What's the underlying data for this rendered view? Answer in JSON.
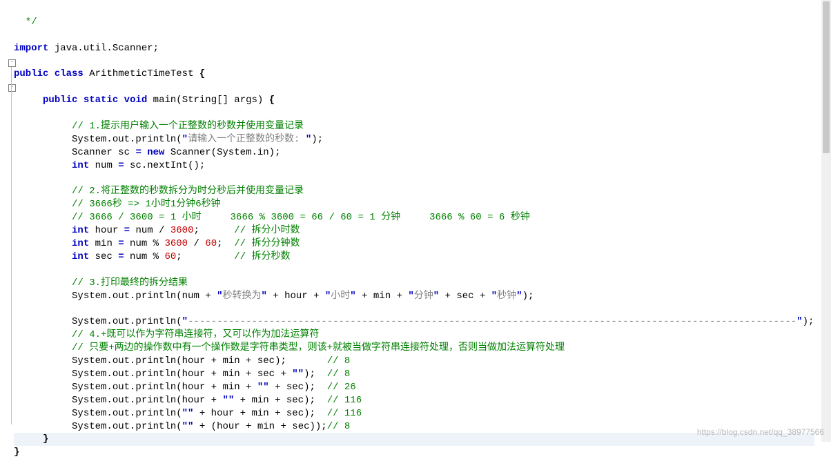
{
  "watermark": "https://blog.csdn.net/qq_38977566",
  "code": {
    "top_fragment": "  */",
    "import_kw": "import",
    "import_rest": " java.util.Scanner;",
    "class_kw1": "public",
    "class_kw2": "class",
    "class_name": " ArithmeticTimeTest ",
    "class_brace": "{",
    "main_kw1": "public",
    "main_kw2": "static",
    "main_kw3": "void",
    "main_sig": " main(String[] args) ",
    "main_brace": "{",
    "c1": "// 1.提示用户输入一个正整数的秒数并使用变量记录",
    "p1a": "System.out.println(",
    "p1q1": "\"",
    "p1s": "请输入一个正整数的秒数: ",
    "p1q2": "\"",
    "p1b": ");",
    "scan_a": "Scanner sc ",
    "scan_eq": "=",
    "scan_new": " new",
    "scan_b": " Scanner(System.in);",
    "int_kw": "int",
    "num_decl": " num ",
    "num_eq": "=",
    "num_rest": " sc.nextInt();",
    "c2a": "// 2.将正整数的秒数拆分为时分秒后并使用变量记录",
    "c2b": "// 3666秒 => 1小时1分钟6秒钟",
    "c2c": "// 3666 / 3600 = 1 小时     3666 % 3600 = 66 / 60 = 1 分钟     3666 % 60 = 6 秒钟",
    "hour_a": " hour ",
    "hour_eq": "=",
    "hour_b": " num / ",
    "hour_n": "3600",
    "hour_c": ";      ",
    "hour_cm": "// 拆分小时数",
    "min_a": " min ",
    "min_eq": "=",
    "min_b": " num % ",
    "min_n1": "3600",
    "min_c": " / ",
    "min_n2": "60",
    "min_d": ";  ",
    "min_cm": "// 拆分分钟数",
    "sec_a": " sec ",
    "sec_eq": "=",
    "sec_b": " num % ",
    "sec_n": "60",
    "sec_c": ";         ",
    "sec_cm": "// 拆分秒数",
    "c3": "// 3.打印最终的拆分结果",
    "p2a": "System.out.println(num + ",
    "p2q1": "\"",
    "p2s1": "秒转换为",
    "p2q2": "\"",
    "p2b": " + hour + ",
    "p2q3": "\"",
    "p2s2": "小时",
    "p2q4": "\"",
    "p2c": " + min + ",
    "p2q5": "\"",
    "p2s3": "分钟",
    "p2q6": "\"",
    "p2d": " + sec + ",
    "p2q7": "\"",
    "p2s4": "秒钟",
    "p2q8": "\"",
    "p2e": ");",
    "p3a": "System.out.println(",
    "p3q1": "\"",
    "p3s": "---------------------------------------------------------------------------------------------------------",
    "p3q2": "\"",
    "p3b": ");",
    "c4a": "// 4.+既可以作为字符串连接符，又可以作为加法运算符",
    "c4b": "// 只要+两边的操作数中有一个操作数是字符串类型，则该+就被当做字符串连接符处理，否则当做加法运算符处理",
    "l1a": "System.out.println(hour + min + sec);       ",
    "l1c": "// 8",
    "l2a": "System.out.println(hour + min + sec + ",
    "l2q1": "\"\"",
    "l2b": ");  ",
    "l2c": "// 8",
    "l3a": "System.out.println(hour + min + ",
    "l3q1": "\"\"",
    "l3b": " + sec);  ",
    "l3c": "// 26",
    "l4a": "System.out.println(hour + ",
    "l4q1": "\"\"",
    "l4b": " + min + sec);  ",
    "l4c": "// 116",
    "l5a": "System.out.println(",
    "l5q1": "\"\"",
    "l5b": " + hour + min + sec);  ",
    "l5c": "// 116",
    "l6a": "System.out.println(",
    "l6q1": "\"\"",
    "l6b": " + (hour + min + sec));",
    "l6c": "// 8",
    "close_method": "}",
    "close_class": "}"
  }
}
